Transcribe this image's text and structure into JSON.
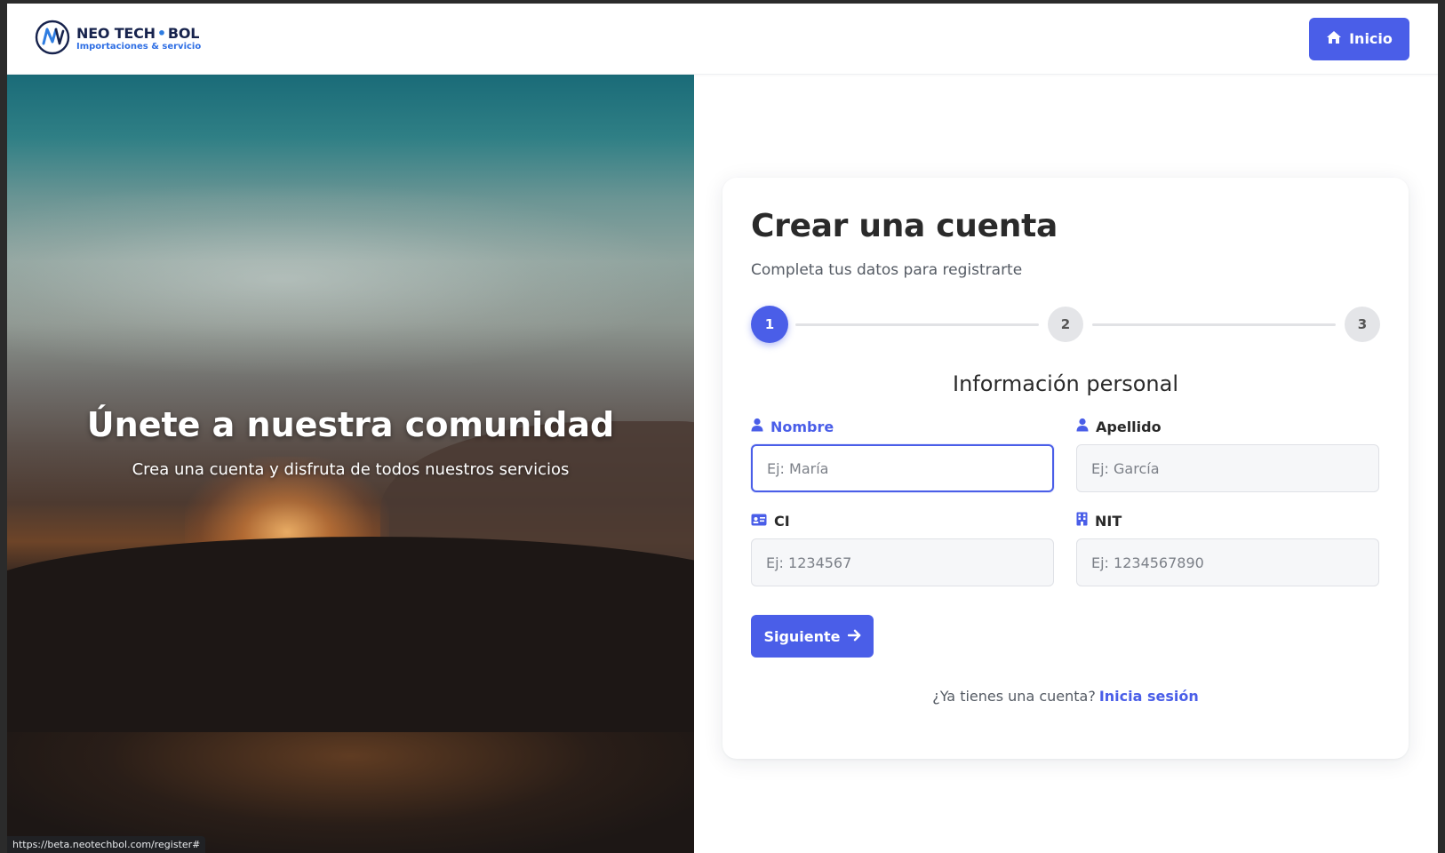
{
  "status_url": "https://beta.neotechbol.com/register#",
  "header": {
    "brand_name_left": "NEO TECH",
    "brand_name_dot": "•",
    "brand_name_right": "BOL",
    "brand_tagline": "Importaciones & servicio",
    "home_button_label": "Inicio"
  },
  "hero": {
    "title": "Únete a nuestra comunidad",
    "subtitle": "Crea una cuenta y disfruta de todos nuestros servicios"
  },
  "form": {
    "title": "Crear una cuenta",
    "subtitle": "Completa tus datos para registrarte",
    "steps": [
      "1",
      "2",
      "3"
    ],
    "active_step": 1,
    "section_title": "Información personal",
    "fields": {
      "nombre": {
        "label": "Nombre",
        "placeholder": "Ej: María",
        "icon": "user-icon"
      },
      "apellido": {
        "label": "Apellido",
        "placeholder": "Ej: García",
        "icon": "user-icon"
      },
      "ci": {
        "label": "CI",
        "placeholder": "Ej: 1234567",
        "icon": "id-card-icon"
      },
      "nit": {
        "label": "NIT",
        "placeholder": "Ej: 1234567890",
        "icon": "building-icon"
      }
    },
    "next_button_label": "Siguiente",
    "login_prompt": "¿Ya tienes una cuenta?",
    "login_link": "Inicia sesión"
  },
  "colors": {
    "accent": "#4a5ee8",
    "brand_dark": "#17234d",
    "brand_blue": "#2f6fe4"
  }
}
